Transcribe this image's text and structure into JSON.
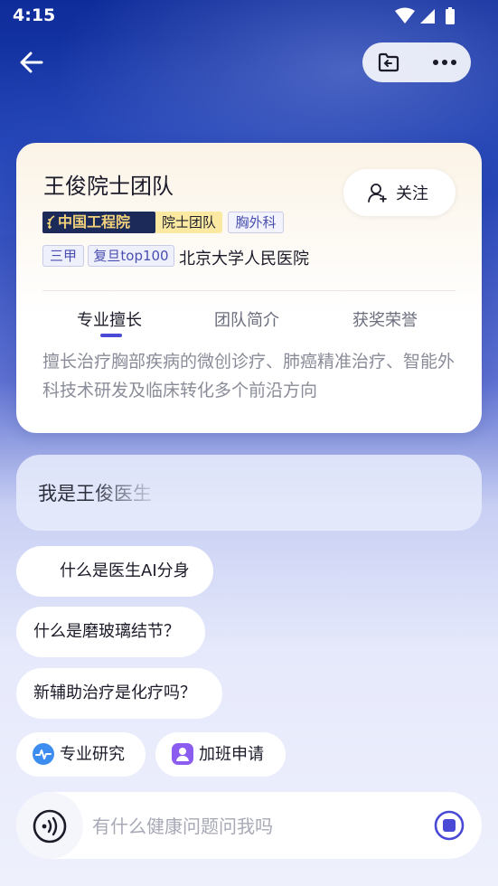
{
  "status_bar": {
    "time": "4:15"
  },
  "card": {
    "doctor_name": "王俊院士团队",
    "follow_label": "关注",
    "tags": {
      "cae": "中国工程院",
      "academician": "院士团队",
      "department": "胸外科",
      "level": "三甲",
      "ranking": "复旦top100"
    },
    "hospital": "北京大学人民医院",
    "tabs": [
      {
        "label": "专业擅长",
        "active": true
      },
      {
        "label": "团队简介",
        "active": false
      },
      {
        "label": "获奖荣誉",
        "active": false
      }
    ],
    "description": "擅长治疗胸部疾病的微创诊疗、肺癌精准治疗、智能外科技术研发及临床转化多个前沿方向"
  },
  "intro": {
    "text": "我是王俊医生"
  },
  "suggestions": [
    {
      "label": "什么是医生AI分身"
    },
    {
      "label": "什么是磨玻璃结节？"
    },
    {
      "label": "新辅助治疗是化疗吗？"
    }
  ],
  "chips": [
    {
      "label": "专业研究",
      "icon": "pulse-icon",
      "color": "#3d8cf0"
    },
    {
      "label": "加班申请",
      "icon": "person-badge-icon",
      "color": "#8a5cf0"
    }
  ],
  "input": {
    "placeholder": "有什么健康问题问我吗",
    "value": ""
  },
  "colors": {
    "accent": "#4a49d6",
    "hero": "#1a3cb0"
  }
}
